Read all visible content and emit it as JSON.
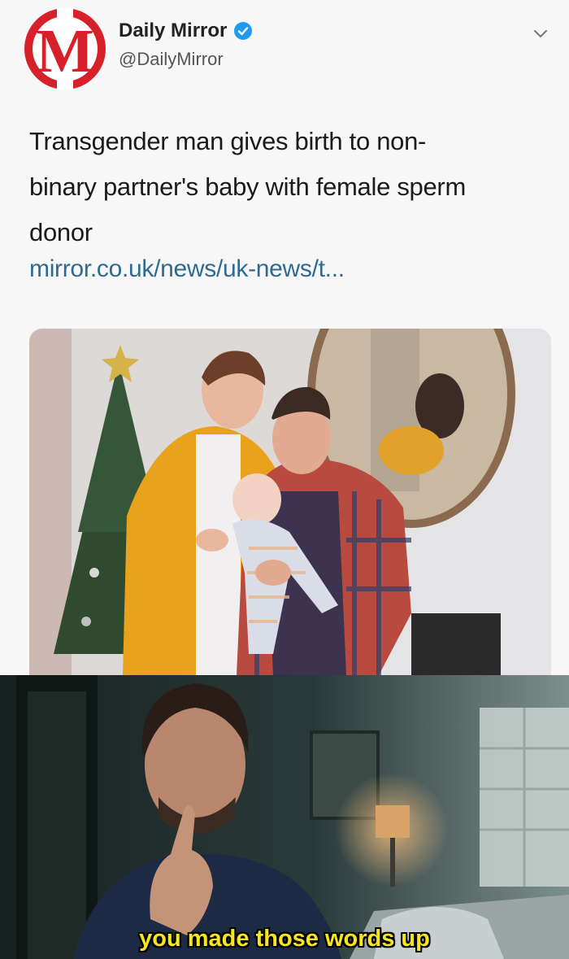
{
  "tweet": {
    "account_name": "Daily Mirror",
    "account_handle": "@DailyMirror",
    "logo_letter": "M",
    "text_lines": [
      "Transgender man gives birth to non-",
      "binary partner's baby with female sperm",
      "donor"
    ],
    "link": "mirror.co.uk/news/uk-news/t...",
    "brand_color": "#d6202a",
    "verified_color": "#1d9bf0"
  },
  "meme": {
    "caption": "you made those words up",
    "caption_color": "#f7e51e"
  }
}
